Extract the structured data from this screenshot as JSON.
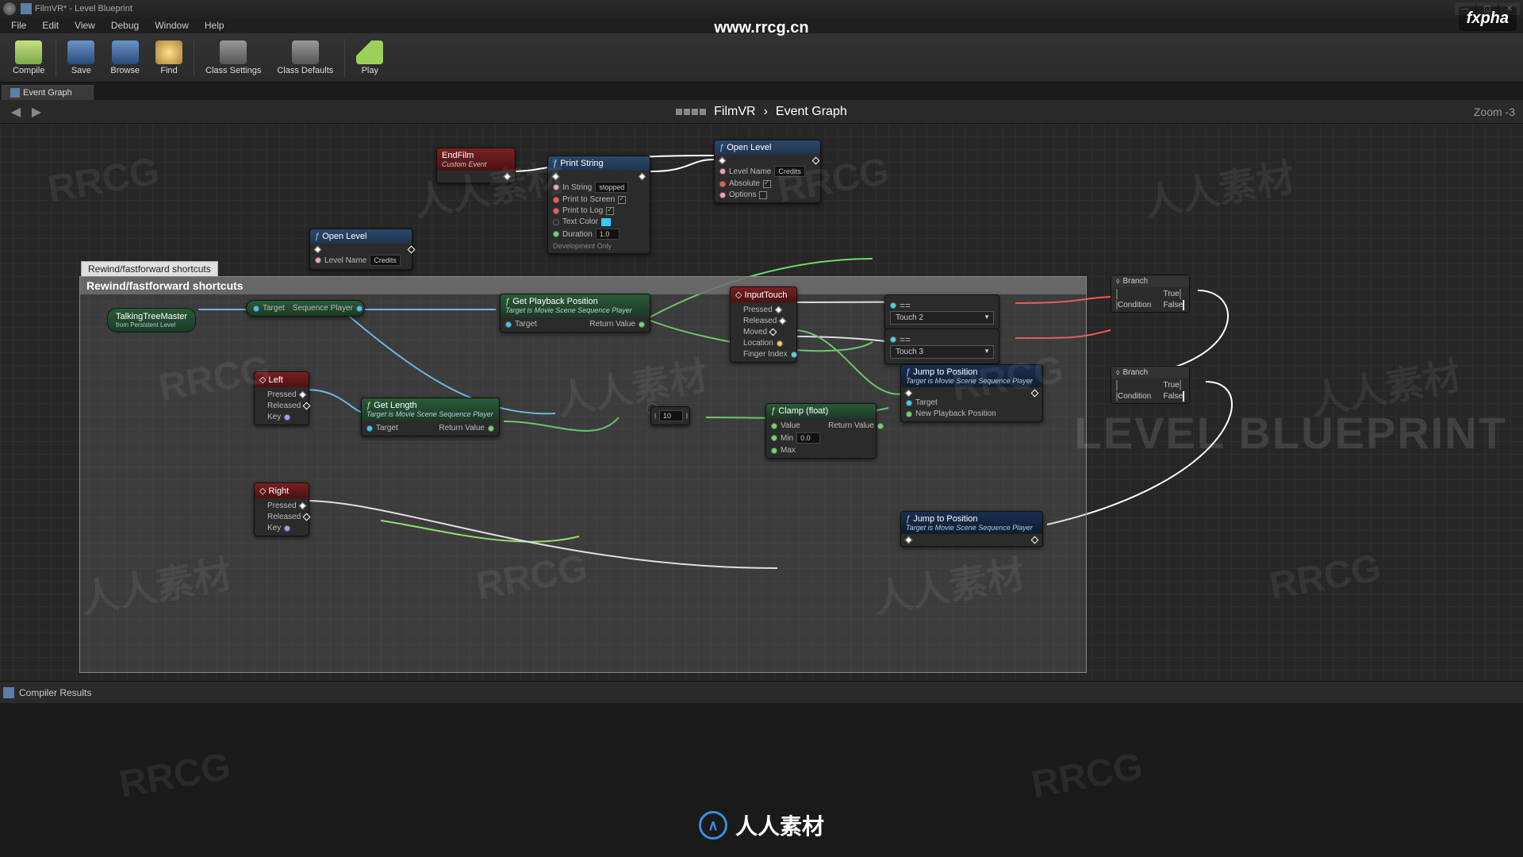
{
  "title": "FilmVR* - Level Blueprint",
  "menus": [
    "File",
    "Edit",
    "View",
    "Debug",
    "Window",
    "Help"
  ],
  "toolbar": [
    {
      "id": "compile",
      "label": "Compile",
      "color": "#7aa84b"
    },
    {
      "id": "save",
      "label": "Save",
      "color": "#4a74a8"
    },
    {
      "id": "browse",
      "label": "Browse",
      "color": "#4a74a8"
    },
    {
      "id": "find",
      "label": "Find",
      "color": "#a07b3c"
    },
    {
      "id": "class-settings",
      "label": "Class Settings",
      "color": "#777"
    },
    {
      "id": "class-defaults",
      "label": "Class Defaults",
      "color": "#777"
    },
    {
      "id": "play",
      "label": "Play",
      "color": "#9bd05a"
    }
  ],
  "tab": "Event Graph",
  "breadcrumb": {
    "root": "FilmVR",
    "leaf": "Event Graph"
  },
  "zoom": "Zoom -3",
  "commentLabel": "Rewind/fastforward shortcuts",
  "commentTitle": "Rewind/fastforward shortcuts",
  "nodes": {
    "endfilm": {
      "title": "EndFilm",
      "sub": "Custom Event"
    },
    "printstring": {
      "title": "Print String",
      "inString": "stopped",
      "printScreen": "Print to Screen",
      "printLog": "Print to Log",
      "textColor": "Text Color",
      "duration": "Duration",
      "durVal": "1.0",
      "dev": "Development Only"
    },
    "openlevel1": {
      "title": "Open Level",
      "levelName": "Level Name",
      "credits": "Credits",
      "absolute": "Absolute",
      "options": "Options"
    },
    "openlevel2": {
      "title": "Open Level",
      "levelName": "Level Name",
      "credits": "Credits"
    },
    "inputtouch": {
      "title": "InputTouch",
      "pressed": "Pressed",
      "released": "Released",
      "moved": "Moved",
      "location": "Location",
      "fingerindex": "Finger Index"
    },
    "touch2": "Touch 2",
    "touch3": "Touch 3",
    "branch": {
      "title": "Branch",
      "cond": "Condition",
      "t": "True",
      "f": "False"
    },
    "jump": {
      "title": "Jump to Position",
      "sub": "Target is Movie Scene Sequence Player",
      "target": "Target",
      "npp": "New Playback Position"
    },
    "getplayback": {
      "title": "Get Playback Position",
      "sub": "Target is Movie Scene Sequence Player",
      "target": "Target",
      "ret": "Return Value"
    },
    "getlength": {
      "title": "Get Length",
      "sub": "Target is Movie Scene Sequence Player",
      "target": "Target",
      "ret": "Return Value"
    },
    "clamp": {
      "title": "Clamp (float)",
      "value": "Value",
      "min": "Min",
      "max": "Max",
      "minVal": "0.0",
      "ret": "Return Value"
    },
    "left": {
      "title": "Left",
      "pressed": "Pressed",
      "released": "Released",
      "key": "Key"
    },
    "right": {
      "title": "Right",
      "pressed": "Pressed",
      "released": "Released",
      "key": "Key"
    },
    "seqvar": {
      "title": "Sequence Player",
      "target": "Target"
    },
    "treevar": {
      "title": "TalkingTreeMaster",
      "sub": "from Persistent Level"
    },
    "tenbox": "10"
  },
  "bottomPanel": "Compiler Results",
  "watermarks": {
    "rrcg": "RRCG",
    "cn": "人人素材",
    "url": "www.rrcg.cn",
    "fxpha": "fxpha",
    "big": "LEVEL BLUEPRINT"
  }
}
